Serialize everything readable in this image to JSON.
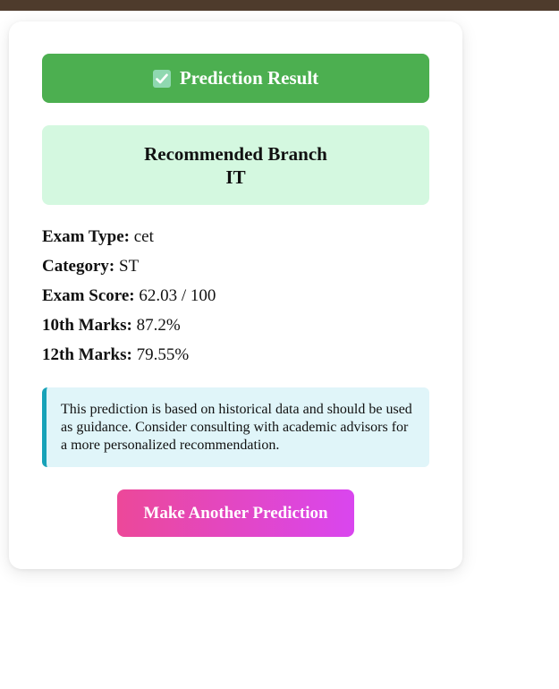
{
  "header": {
    "icon": "check-box-icon",
    "title": "Prediction Result",
    "color": "#4caf50"
  },
  "branch": {
    "label": "Recommended Branch",
    "value": "IT"
  },
  "details": [
    {
      "label": "Exam Type:",
      "value": "cet"
    },
    {
      "label": "Category:",
      "value": "ST"
    },
    {
      "label": "Exam Score:",
      "value": "62.03 / 100"
    },
    {
      "label": "10th Marks:",
      "value": "87.2%"
    },
    {
      "label": "12th Marks:",
      "value": "79.55%"
    }
  ],
  "note": {
    "text": "This prediction is based on historical data and should be used as guidance. Consider consulting with academic advisors for a more personalized recommendation.",
    "accent": "#17a2b8"
  },
  "actions": {
    "again_label": "Make Another Prediction"
  }
}
